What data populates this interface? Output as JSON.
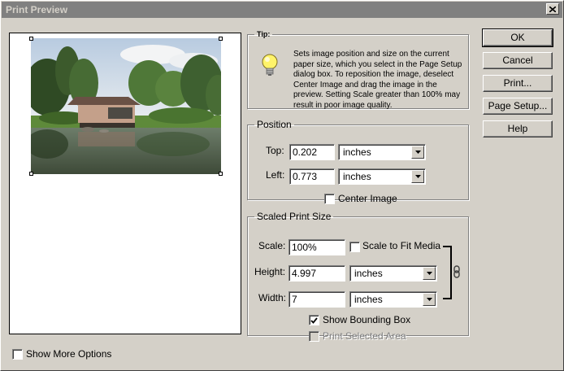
{
  "window": {
    "title": "Print Preview"
  },
  "tip": {
    "label": "Tip:",
    "icon": "lightbulb-icon",
    "text": "Sets image position and size on the current paper size, which you select in the Page Setup dialog box. To reposition the image, deselect Center Image and drag the image in the preview. Setting Scale greater than 100% may result in poor image quality."
  },
  "position": {
    "legend": "Position",
    "top_label": "Top:",
    "top_value": "0.202",
    "top_unit": "inches",
    "left_label": "Left:",
    "left_value": "0.773",
    "left_unit": "inches",
    "center_image_label": "Center Image",
    "center_image_checked": false
  },
  "scaled": {
    "legend": "Scaled Print Size",
    "scale_label": "Scale:",
    "scale_value": "100%",
    "scale_to_fit_label": "Scale to Fit Media",
    "height_label": "Height:",
    "height_value": "4.997",
    "height_unit": "inches",
    "width_label": "Width:",
    "width_value": "7",
    "width_unit": "inches",
    "show_bounding_box_label": "Show Bounding Box",
    "show_bounding_box_checked": true,
    "print_selected_area_label": "Print Selected Area",
    "print_selected_area_enabled": false,
    "link_icon": "chain-link-icon"
  },
  "buttons": {
    "ok": "OK",
    "cancel": "Cancel",
    "print": "Print...",
    "page_setup": "Page Setup...",
    "help": "Help"
  },
  "more_options": {
    "label": "Show More Options",
    "checked": false
  }
}
